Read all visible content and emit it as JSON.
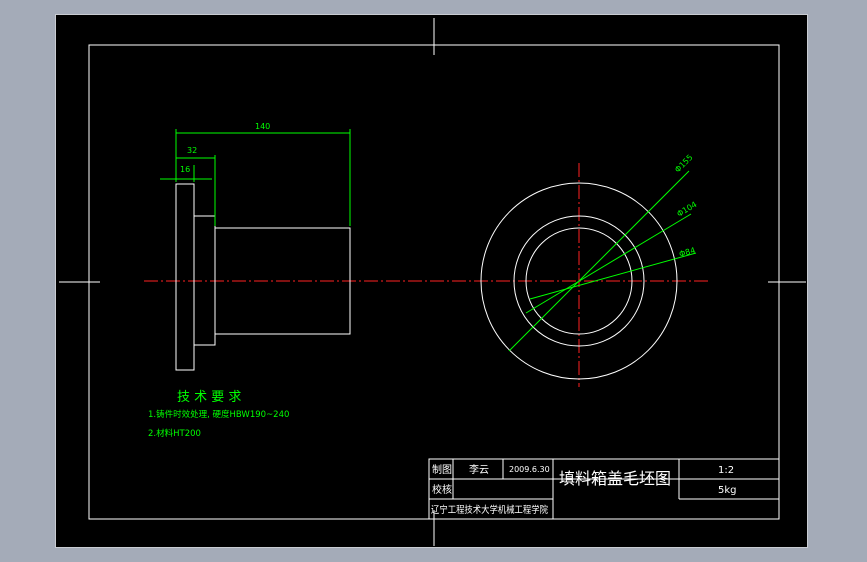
{
  "colors": {
    "background": "#000000",
    "outline": "#ffffff",
    "dimension": "#00ff00",
    "centerline": "#ff0000",
    "notes": "#00ff00",
    "viewport": "#a4abb8"
  },
  "dimensions": {
    "overall_length": "140",
    "flange_step": "32",
    "flange_thickness": "16",
    "dia_outer": "Φ155",
    "dia_mid": "Φ104",
    "dia_bore": "Φ84"
  },
  "notes": {
    "heading": "技 术 要 求",
    "items": [
      "1.铸件时效处理, 硬度HBW190~240",
      "2.材料HT200"
    ]
  },
  "title_block": {
    "drawn_label": "制图",
    "drawn_name": "李云",
    "drawn_date": "2009.6.30",
    "check_label": "校核",
    "drawing_title": "填料箱盖毛坯图",
    "scale": "1:2",
    "weight": "5kg",
    "organization": "辽宁工程技术大学机械工程学院"
  }
}
